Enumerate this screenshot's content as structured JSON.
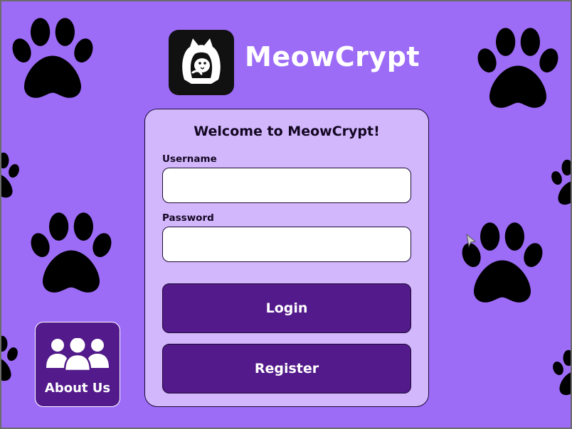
{
  "app": {
    "title": "MeowCrypt",
    "logo_icon": "hooded-cat-icon"
  },
  "login_card": {
    "title": "Welcome to MeowCrypt!",
    "username_label": "Username",
    "username_value": "",
    "password_label": "Password",
    "password_value": "",
    "login_label": "Login",
    "register_label": "Register"
  },
  "about": {
    "label": "About Us",
    "icon": "team-icon"
  },
  "theme": {
    "background": "#9d6cf7",
    "paw_color": "#c6a5f8",
    "card_background": "#d3b7fd",
    "button_color": "#521a8a",
    "text_dark": "#130722"
  }
}
